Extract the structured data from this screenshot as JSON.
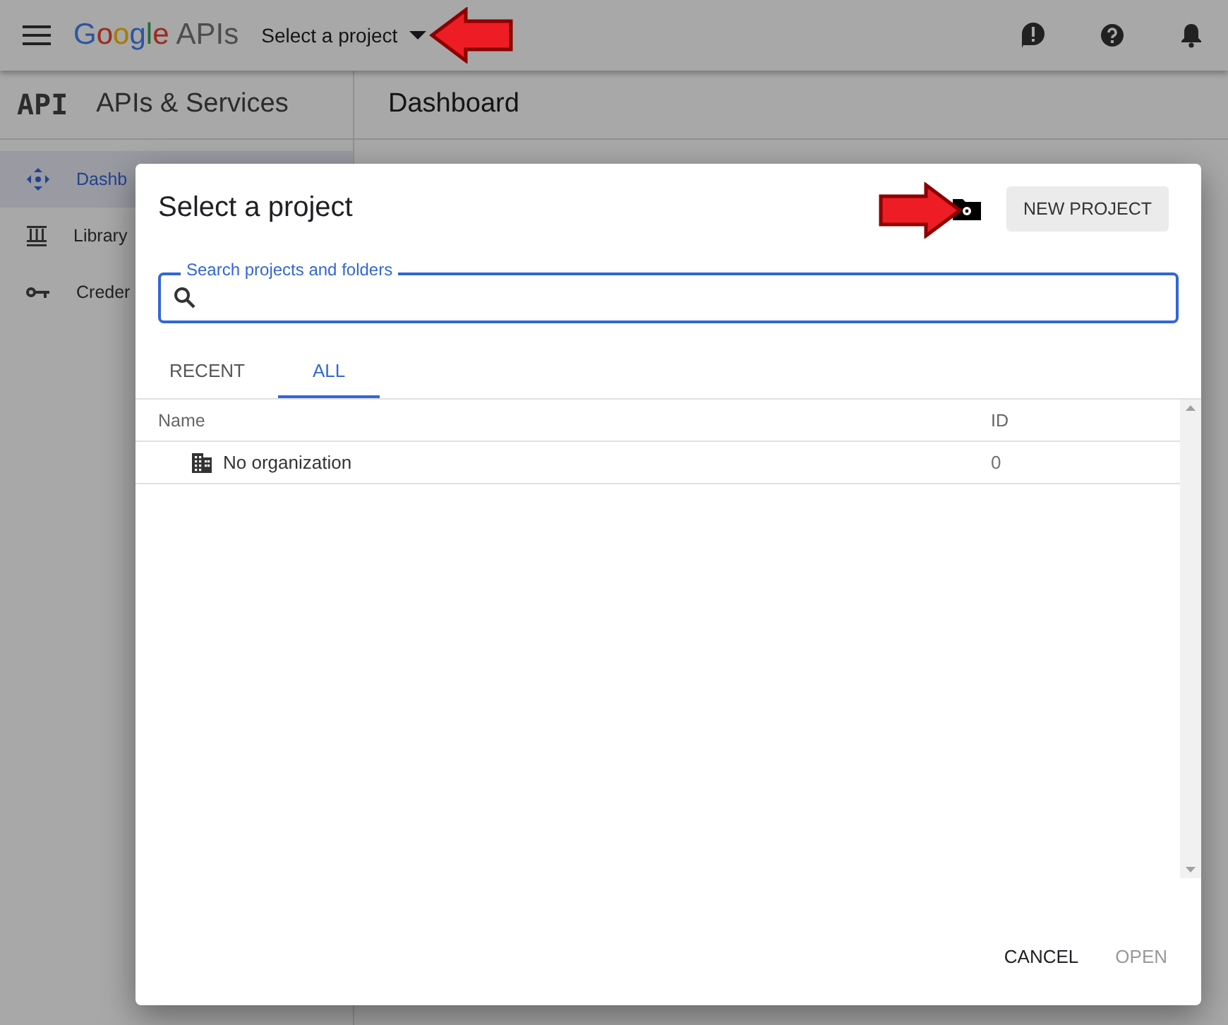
{
  "header": {
    "logo_brand": "Google",
    "logo_product": "APIs",
    "project_picker": "Select a project"
  },
  "sidebar": {
    "logo": "API",
    "title": "APIs & Services",
    "items": [
      {
        "label": "Dashb",
        "kind": "dashboard",
        "selected": true
      },
      {
        "label": "Library",
        "kind": "library",
        "selected": false
      },
      {
        "label": "Creder",
        "kind": "key",
        "selected": false
      }
    ]
  },
  "page": {
    "title": "Dashboard"
  },
  "dialog": {
    "title": "Select a project",
    "new_project_button": "NEW PROJECT",
    "search": {
      "label": "Search projects and folders"
    },
    "tabs": [
      {
        "label": "RECENT",
        "selected": false
      },
      {
        "label": "ALL",
        "selected": true
      }
    ],
    "table": {
      "columns": [
        "Name",
        "ID"
      ],
      "rows": [
        {
          "name": "No organization",
          "id": "0"
        }
      ]
    },
    "buttons": [
      {
        "label": "CANCEL",
        "disabled": false
      },
      {
        "label": "OPEN",
        "disabled": true
      }
    ]
  }
}
